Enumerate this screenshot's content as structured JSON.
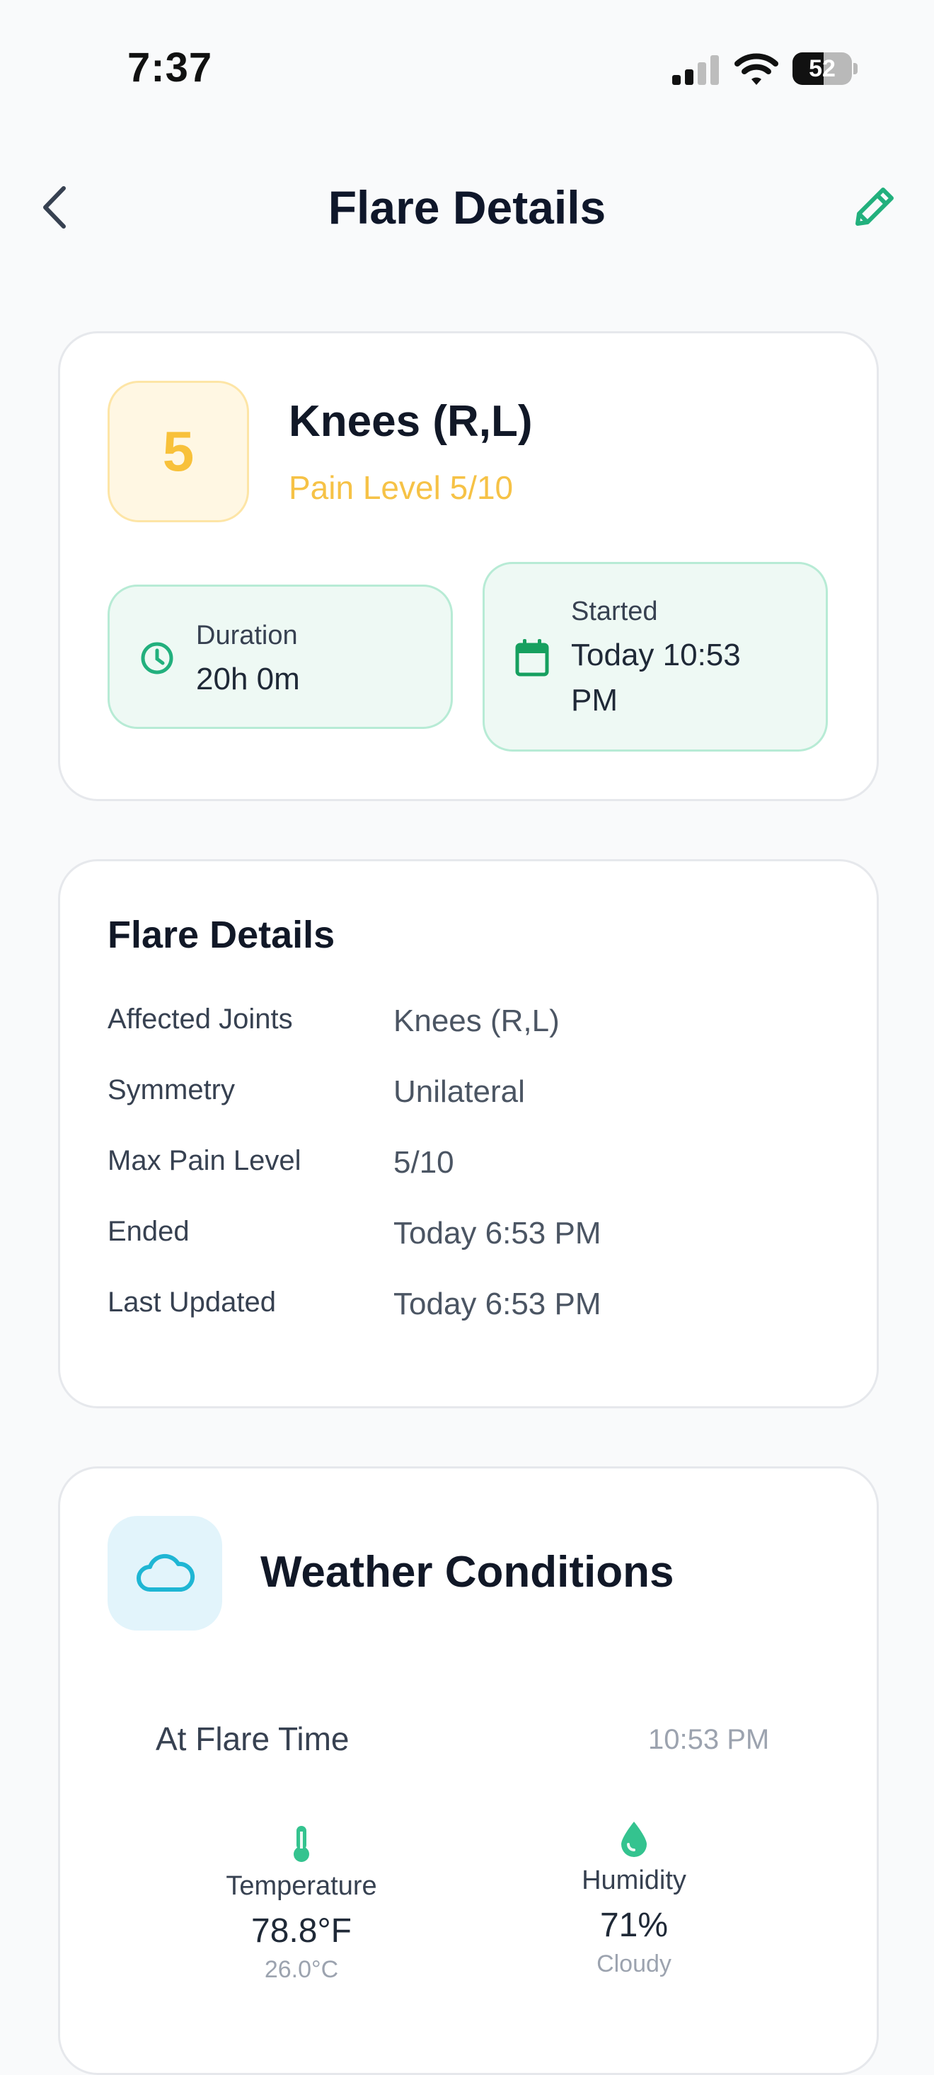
{
  "status_bar": {
    "time": "7:37",
    "battery": "52",
    "battery_level": 0.52
  },
  "header": {
    "title": "Flare Details",
    "back_icon": "chevron-left-icon",
    "edit_icon": "pencil-icon"
  },
  "summary": {
    "pain_number": "5",
    "joint": "Knees (R,L)",
    "pain_level": "Pain Level 5/10",
    "duration_label": "Duration",
    "duration_value": "20h 0m",
    "started_label": "Started",
    "started_value_line1": "Today 10:53",
    "started_value_line2": "PM"
  },
  "details": {
    "title": "Flare Details",
    "rows": [
      {
        "label": "Affected Joints",
        "value": "Knees (R,L)"
      },
      {
        "label": "Symmetry",
        "value": "Unilateral"
      },
      {
        "label": "Max Pain Level",
        "value": "5/10"
      },
      {
        "label": "Ended",
        "value": "Today 6:53 PM"
      },
      {
        "label": "Last Updated",
        "value": "Today 6:53 PM"
      }
    ]
  },
  "weather": {
    "title": "Weather Conditions",
    "at_label": "At Flare Time",
    "at_time": "10:53 PM",
    "temperature": {
      "label": "Temperature",
      "value": "78.8°F",
      "sub": "26.0°C"
    },
    "humidity": {
      "label": "Humidity",
      "value": "71%",
      "sub": "Cloudy"
    }
  },
  "colors": {
    "accent_green": "#22b07d",
    "pain_yellow": "#f8c13a",
    "weather_cyan": "#1fb6d4"
  }
}
